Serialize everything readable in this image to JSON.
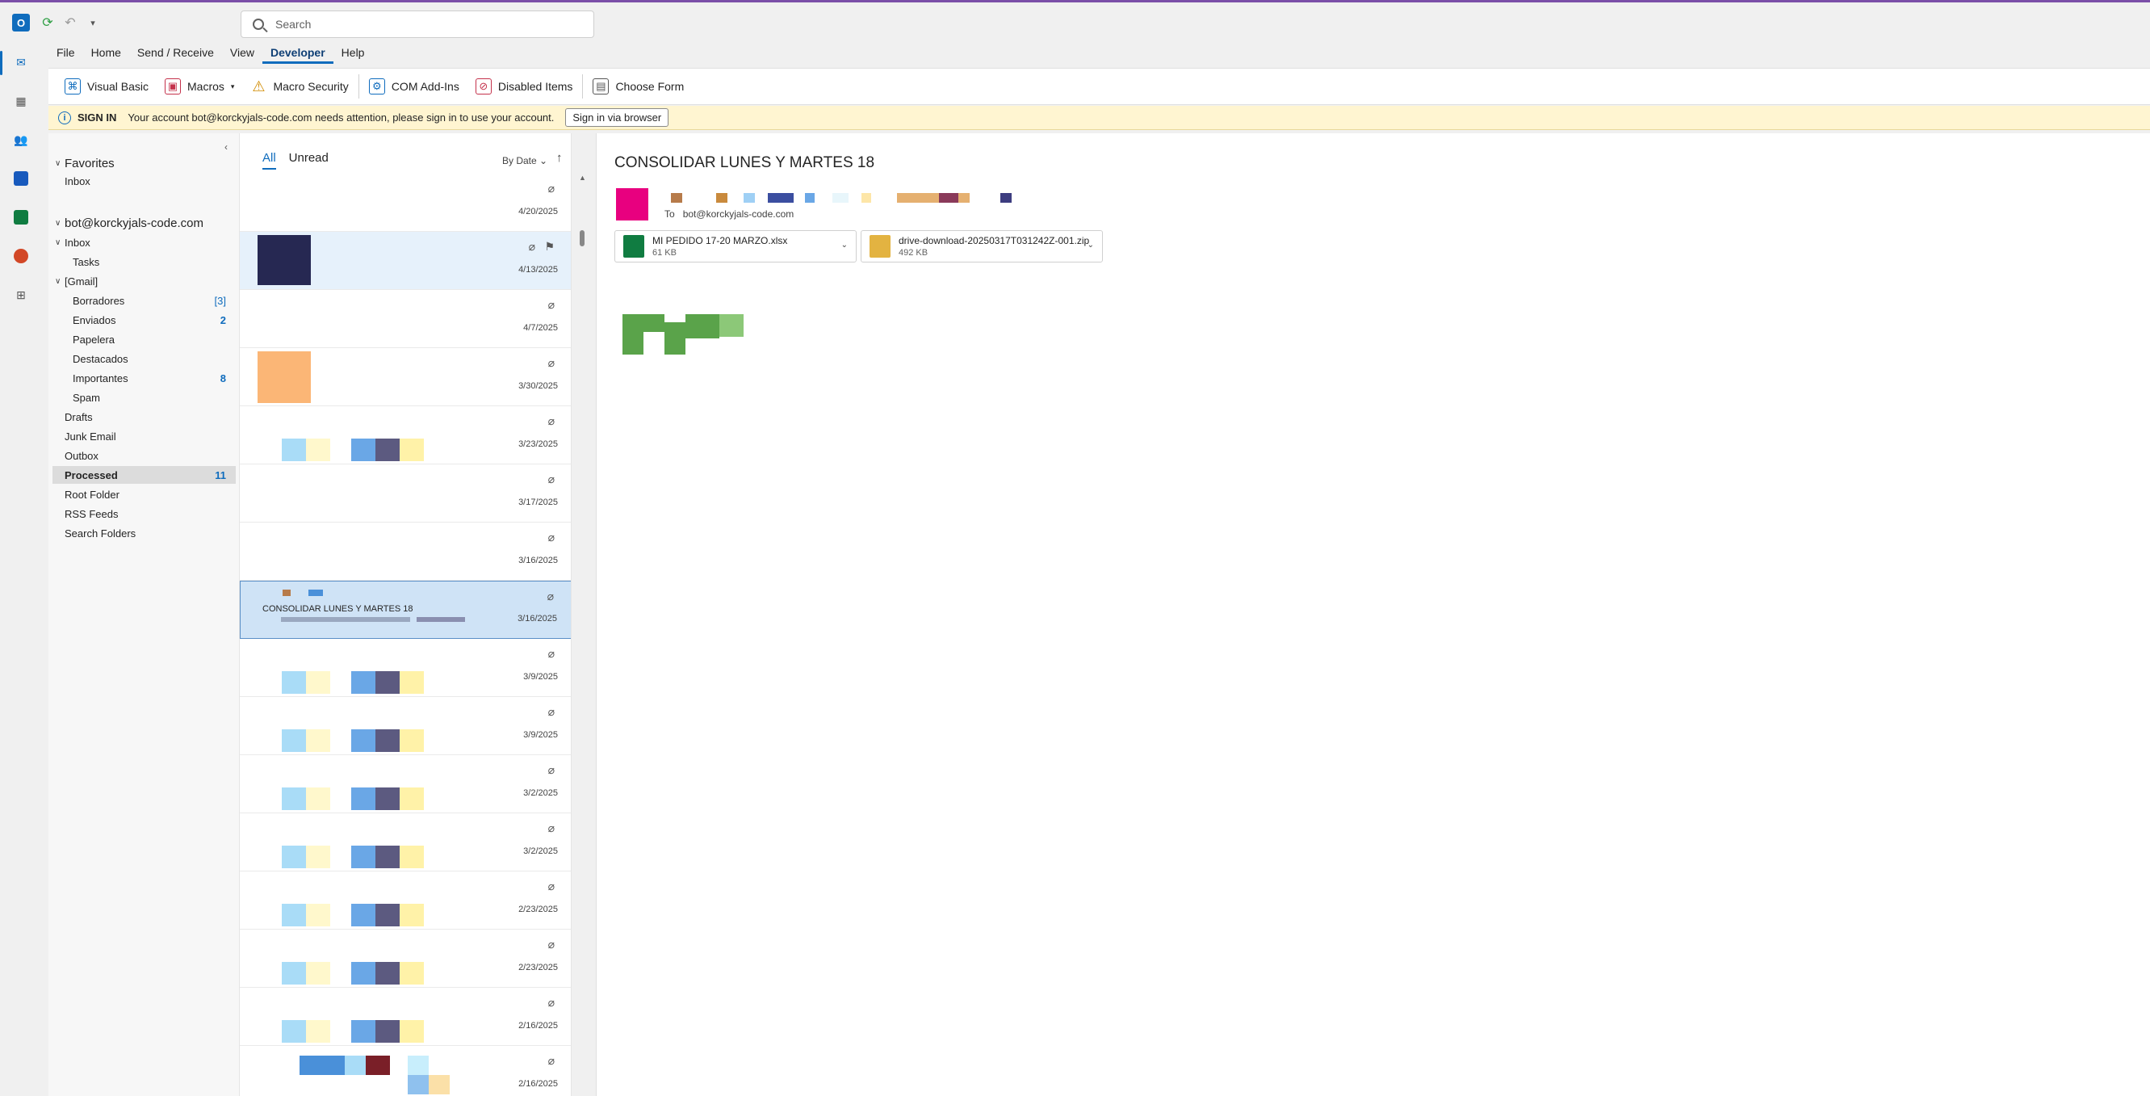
{
  "app": {
    "search_placeholder": "Search"
  },
  "ribbon_tabs": [
    "File",
    "Home",
    "Send / Receive",
    "View",
    "Developer",
    "Help"
  ],
  "ribbon_buttons": {
    "visual_basic": "Visual Basic",
    "macros": "Macros",
    "macro_security": "Macro Security",
    "com_addins": "COM Add-Ins",
    "disabled_items": "Disabled Items",
    "choose_form": "Choose Form"
  },
  "signin_bar": {
    "label": "SIGN IN",
    "message": "Your account bot@korckyjals-code.com needs attention, please sign in to use your account.",
    "button": "Sign in via browser"
  },
  "folders": {
    "favorites_header": "Favorites",
    "favorites_inbox": "Inbox",
    "account": "bot@korckyjals-code.com",
    "inbox": "Inbox",
    "tasks": "Tasks",
    "gmail": "[Gmail]",
    "borradores": "Borradores",
    "borradores_count": "[3]",
    "enviados": "Enviados",
    "enviados_count": "2",
    "papelera": "Papelera",
    "destacados": "Destacados",
    "importantes": "Importantes",
    "importantes_count": "8",
    "spam": "Spam",
    "drafts": "Drafts",
    "junk": "Junk Email",
    "outbox": "Outbox",
    "processed": "Processed",
    "processed_count": "11",
    "root": "Root Folder",
    "rss": "RSS Feeds",
    "search_folders": "Search Folders"
  },
  "list": {
    "filter_all": "All",
    "filter_unread": "Unread",
    "sort_by": "By Date",
    "messages": [
      {
        "date": "4/20/2025"
      },
      {
        "date": "4/13/2025"
      },
      {
        "date": "4/7/2025"
      },
      {
        "date": "3/30/2025"
      },
      {
        "date": "3/23/2025"
      },
      {
        "date": "3/17/2025"
      },
      {
        "date": "3/16/2025"
      },
      {
        "date": "3/16/2025",
        "subject": "CONSOLIDAR LUNES Y MARTES 18"
      },
      {
        "date": "3/9/2025"
      },
      {
        "date": "3/9/2025"
      },
      {
        "date": "3/2/2025"
      },
      {
        "date": "3/2/2025"
      },
      {
        "date": "2/23/2025"
      },
      {
        "date": "2/23/2025"
      },
      {
        "date": "2/16/2025"
      },
      {
        "date": "2/16/2025"
      }
    ]
  },
  "reading": {
    "subject": "CONSOLIDAR LUNES Y MARTES 18",
    "to_label": "To",
    "to_address": "bot@korckyjals-code.com",
    "attachments": [
      {
        "name": "MI PEDIDO 17-20 MARZO.xlsx",
        "size": "61 KB"
      },
      {
        "name": "drive-download-20250317T031242Z-001.zip",
        "size": "492 KB"
      }
    ]
  },
  "colors": {
    "accent": "#0f6cbd",
    "avatar": "#e8007f",
    "signin_bg": "#fff5d1"
  }
}
